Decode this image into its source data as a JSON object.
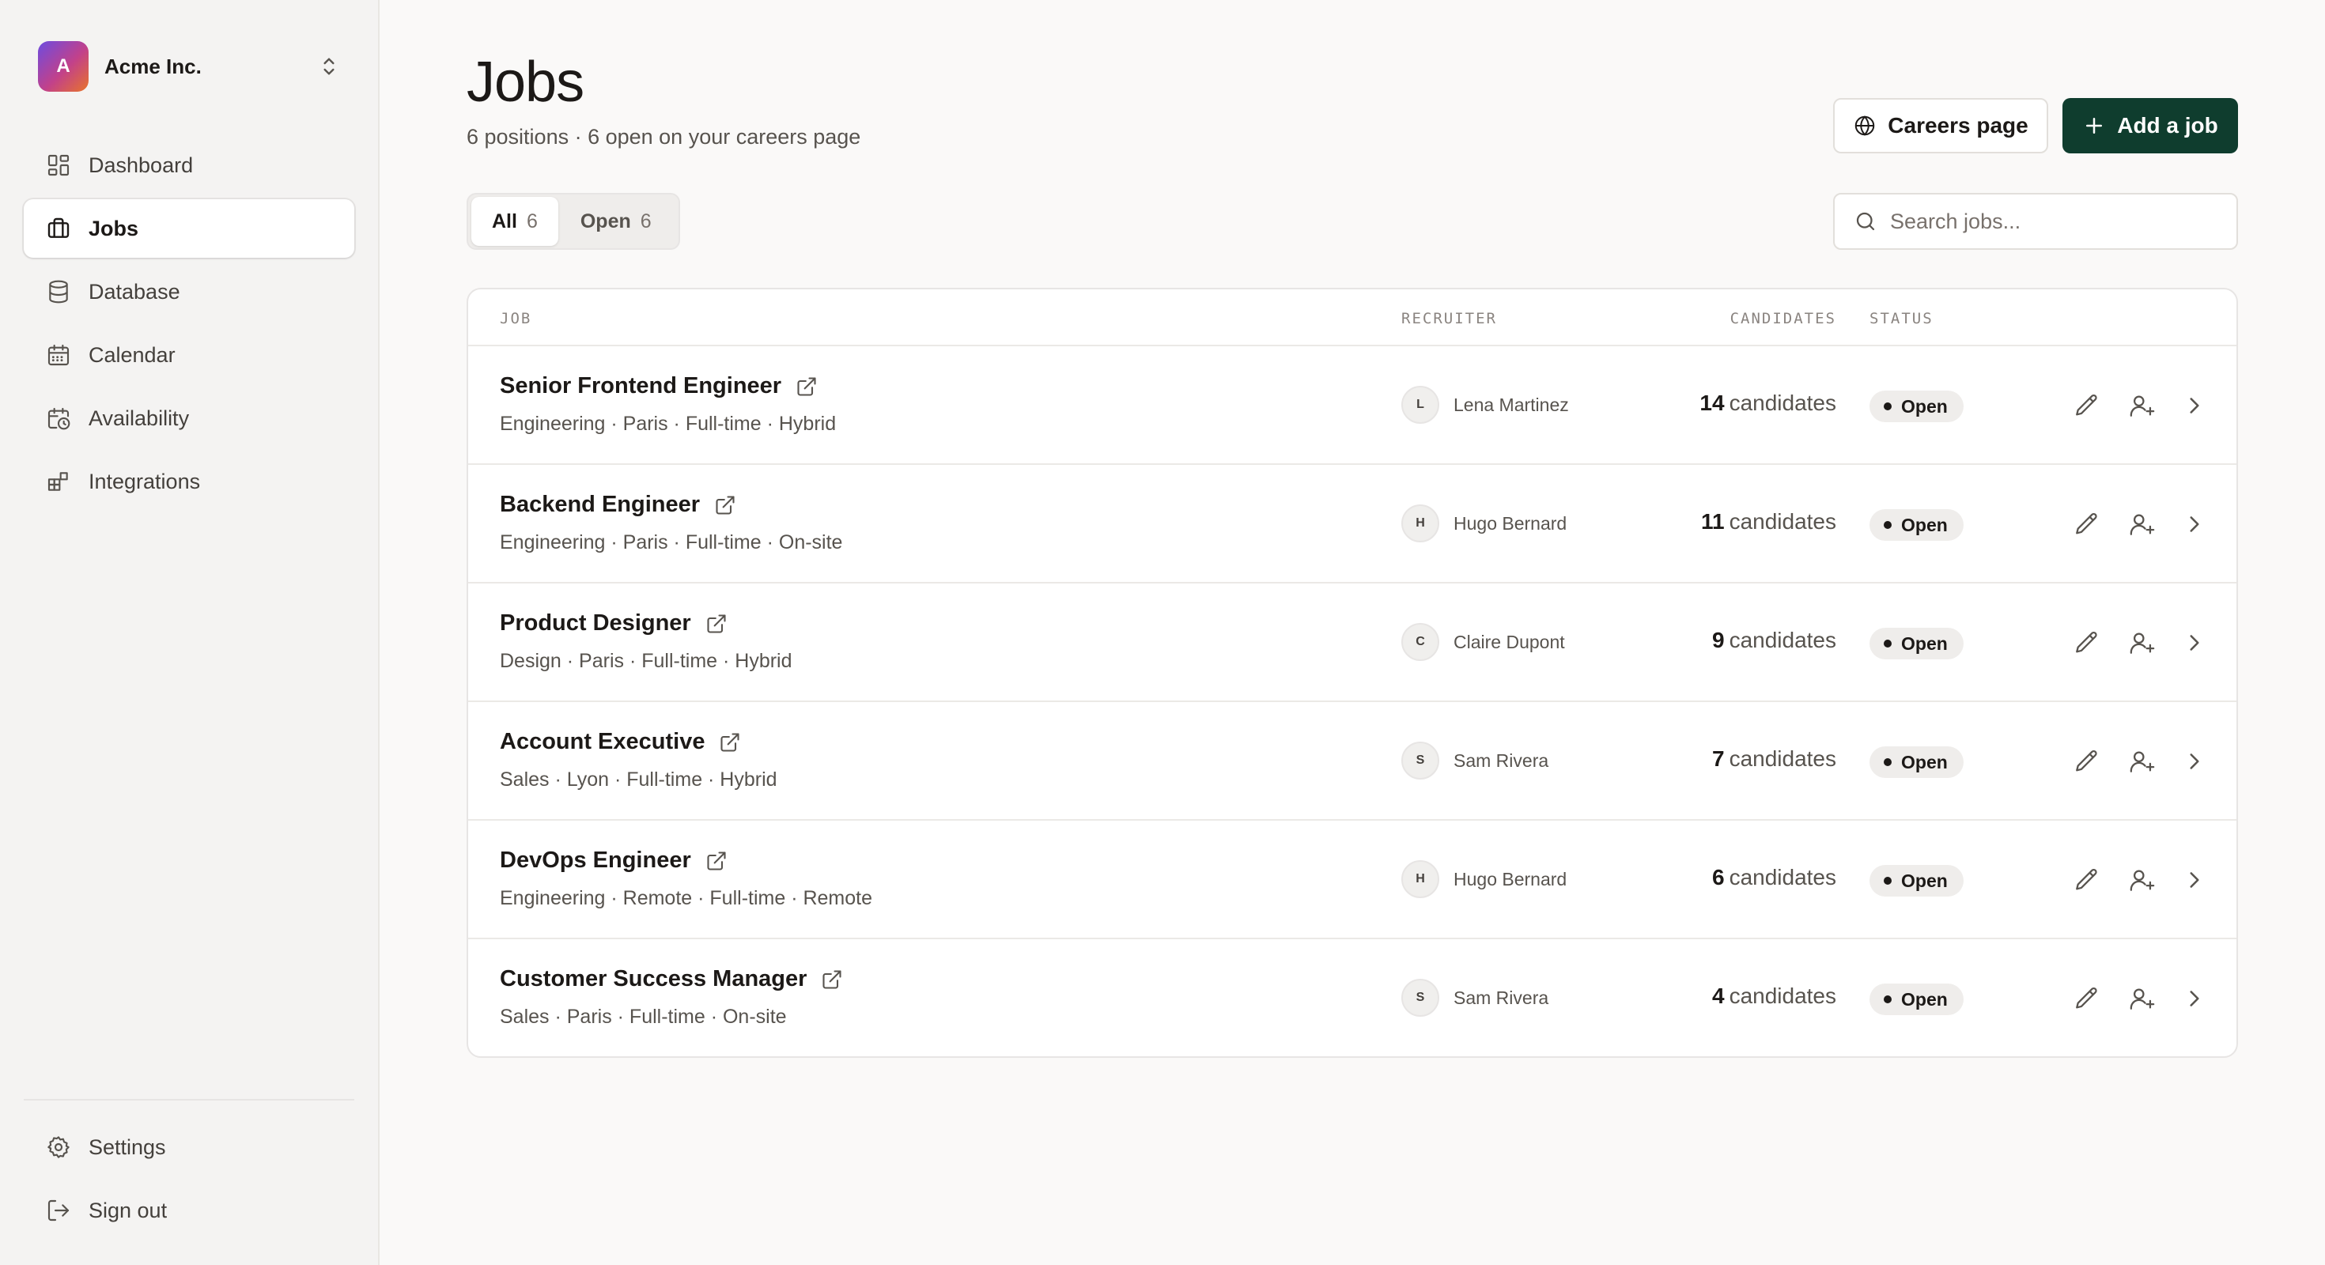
{
  "org": {
    "initial": "A",
    "name": "Acme Inc."
  },
  "nav": [
    {
      "label": "Dashboard",
      "icon": "dashboard-icon",
      "active": false
    },
    {
      "label": "Jobs",
      "icon": "briefcase-icon",
      "active": true
    },
    {
      "label": "Database",
      "icon": "database-icon",
      "active": false
    },
    {
      "label": "Calendar",
      "icon": "calendar-icon",
      "active": false
    },
    {
      "label": "Availability",
      "icon": "calendar-clock-icon",
      "active": false
    },
    {
      "label": "Integrations",
      "icon": "integrations-icon",
      "active": false
    }
  ],
  "nav_bottom": [
    {
      "label": "Settings",
      "icon": "gear-icon"
    },
    {
      "label": "Sign out",
      "icon": "sign-out-icon"
    }
  ],
  "page": {
    "title": "Jobs",
    "subtitle": "6 positions · 6 open on your careers page"
  },
  "actions": {
    "careers_label": "Careers page",
    "add_label": "Add a job"
  },
  "filters": {
    "tabs": [
      {
        "label": "All",
        "count": "6",
        "active": true
      },
      {
        "label": "Open",
        "count": "6",
        "active": false
      }
    ]
  },
  "search": {
    "placeholder": "Search jobs...",
    "value": ""
  },
  "table": {
    "headers": {
      "job": "JOB",
      "recruiter": "RECRUITER",
      "candidates": "CANDIDATES",
      "status": "STATUS"
    },
    "rows": [
      {
        "title": "Senior Frontend Engineer",
        "meta": "Engineering · Paris · Full-time · Hybrid",
        "recruiter_initial": "L",
        "recruiter": "Lena Martinez",
        "count": "14",
        "count_label": "candidates",
        "status": "Open"
      },
      {
        "title": "Backend Engineer",
        "meta": "Engineering · Paris · Full-time · On-site",
        "recruiter_initial": "H",
        "recruiter": "Hugo Bernard",
        "count": "11",
        "count_label": "candidates",
        "status": "Open"
      },
      {
        "title": "Product Designer",
        "meta": "Design · Paris · Full-time · Hybrid",
        "recruiter_initial": "C",
        "recruiter": "Claire Dupont",
        "count": "9",
        "count_label": "candidates",
        "status": "Open"
      },
      {
        "title": "Account Executive",
        "meta": "Sales · Lyon · Full-time · Hybrid",
        "recruiter_initial": "S",
        "recruiter": "Sam Rivera",
        "count": "7",
        "count_label": "candidates",
        "status": "Open"
      },
      {
        "title": "DevOps Engineer",
        "meta": "Engineering · Remote · Full-time · Remote",
        "recruiter_initial": "H",
        "recruiter": "Hugo Bernard",
        "count": "6",
        "count_label": "candidates",
        "status": "Open"
      },
      {
        "title": "Customer Success Manager",
        "meta": "Sales · Paris · Full-time · On-site",
        "recruiter_initial": "S",
        "recruiter": "Sam Rivera",
        "count": "4",
        "count_label": "candidates",
        "status": "Open"
      }
    ]
  },
  "colors": {
    "brand_button": "#0f3d2e",
    "background": "#faf9f8",
    "sidebar": "#f4f3f2"
  }
}
